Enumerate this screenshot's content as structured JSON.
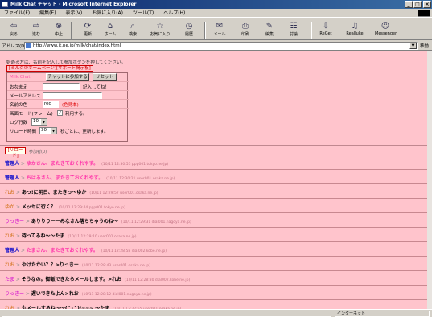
{
  "window": {
    "title": "Milk Chat チャット - Microsoft Internet Explorer",
    "controls": [
      "_",
      "□",
      "×"
    ]
  },
  "menu": [
    "ファイル(F)",
    "編集(E)",
    "表示(V)",
    "お気に入り(A)",
    "ツール(T)",
    "ヘルプ(H)"
  ],
  "toolbar": [
    {
      "label": "戻る",
      "icon": "back-arrow-icon",
      "glyph": "⇦"
    },
    {
      "label": "進む",
      "icon": "forward-arrow-icon",
      "glyph": "⇨"
    },
    {
      "label": "中止",
      "icon": "stop-icon",
      "glyph": "⊗"
    },
    {
      "label": "更新",
      "icon": "refresh-icon",
      "glyph": "⟳"
    },
    {
      "label": "ホーム",
      "icon": "home-icon",
      "glyph": "⌂"
    },
    {
      "label": "検索",
      "icon": "search-icon",
      "glyph": "⌕"
    },
    {
      "label": "お気に入り",
      "icon": "favorites-icon",
      "glyph": "☆"
    },
    {
      "label": "履歴",
      "icon": "history-icon",
      "glyph": "◷"
    },
    {
      "label": "メール",
      "icon": "mail-icon",
      "glyph": "✉"
    },
    {
      "label": "印刷",
      "icon": "print-icon",
      "glyph": "⎙"
    },
    {
      "label": "編集",
      "icon": "edit-icon",
      "glyph": "✎"
    },
    {
      "label": "討論",
      "icon": "discuss-icon",
      "glyph": "☷"
    },
    {
      "label": "ReGet",
      "icon": "reget-icon",
      "glyph": "⇩"
    },
    {
      "label": "RealJuke",
      "icon": "realjukebox-icon",
      "glyph": "♫"
    },
    {
      "label": "Messenger",
      "icon": "messenger-icon",
      "glyph": "☺"
    }
  ],
  "address": {
    "label": "アドレス(D)",
    "url": "http://www.it.ne.jp/milk/chat/index.html",
    "go": "移動"
  },
  "chatform": {
    "instructions": "始める方は、名前を記入して参加ボタンを押してください。",
    "links": "[ミルクのホームページ][サポート掲示板]",
    "title_label": "Milk Chat",
    "join_button": "チャットに参加する",
    "reset_button": "リセット",
    "name_label": "おなまえ",
    "name_note": "記入してね！",
    "mail_label": "メールアドレス",
    "color_label": "名前の色",
    "color_value": "red",
    "color_note": "(色見本)",
    "frame_label": "画面モード(フレーム)",
    "frame_check": "✓",
    "frame_note": "利用する。",
    "lines_label": "ログ行数",
    "lines_value": "10",
    "reload_label": "リロード時間",
    "reload_value": "30",
    "reload_note": "秒ごとに、更新します。"
  },
  "reload_bar": {
    "button": "[リロード]",
    "note": "参加者(0)"
  },
  "messages": [
    {
      "name": "管理人",
      "name_class": "n-admin",
      "text": "ゆかさん、またきておくれやす。",
      "text_class": "m-pink",
      "meta": "(10/11 12:30:53 ppp001.tokyo.ne.jp)"
    },
    {
      "name": "管理人",
      "name_class": "n-admin",
      "text": "ちはるさん、またきておくれやす。",
      "text_class": "m-pink",
      "meta": "(10/11 12:30:21 user001.osaka.ne.jp)"
    },
    {
      "name": "れお",
      "name_class": "n-other",
      "text": "あっ!に明日、またきっ～ゆか",
      "text_class": "m-dark",
      "meta": "(10/11 12:29:57 user001.osaka.ne.jp)"
    },
    {
      "name": "ゆか",
      "name_class": "n-other",
      "text": "メッセに行く？",
      "text_class": "m-dark",
      "meta": "(10/11 12:29:44 ppp001.tokyo.ne.jp)"
    },
    {
      "name": "りっきー",
      "name_class": "n-user",
      "text": "ありりりーーみなさん落ちちゃうのね～",
      "text_class": "m-dark",
      "meta": "(10/11 12:29:31 dial001.nagoya.ne.jp)"
    },
    {
      "name": "れお",
      "name_class": "n-other",
      "text": "待ってるね～～たま",
      "text_class": "m-dark",
      "meta": "(10/11 12:29:10 user001.osaka.ne.jp)"
    },
    {
      "name": "管理人",
      "name_class": "n-admin",
      "text": "たまさん、またきておくれやす。",
      "text_class": "m-pink",
      "meta": "(10/11 12:28:58 dial002.kobe.ne.jp)"
    },
    {
      "name": "れお",
      "name_class": "n-other",
      "text": "やけたかい？？>りっきー",
      "text_class": "m-dark",
      "meta": "(10/11 12:28:43 user001.osaka.ne.jp)"
    },
    {
      "name": "たま",
      "name_class": "n-user",
      "text": "そうなの。御飯できたらメールします。>れお",
      "text_class": "m-dark",
      "meta": "(10/11 12:28:30 dial002.kobe.ne.jp)"
    },
    {
      "name": "りっきー",
      "name_class": "n-user",
      "text": "遅いできたよん>れお",
      "text_class": "m-dark",
      "meta": "(10/11 12:28:12 dial001.nagoya.ne.jp)"
    },
    {
      "name": "れお",
      "name_class": "n-other",
      "text": "丸メールするね～～(^-^)/~~~ ～たま",
      "text_class": "m-dark",
      "meta": "(10/11 12:27:55 user001.osaka.ne.jp)"
    },
    {
      "name": "管理人",
      "name_class": "n-admin",
      "text": "りっきーさん、おいでやす。",
      "text_class": "m-pink",
      "meta": "Mozilla/4.0 (compatible; MSIE 5.0; Windows 98; Win 9x 4.90) (10/11 12:27:40 dial001.nagoya.ne.jp)"
    }
  ],
  "statusbar": {
    "status": "",
    "zone": "インターネット"
  }
}
